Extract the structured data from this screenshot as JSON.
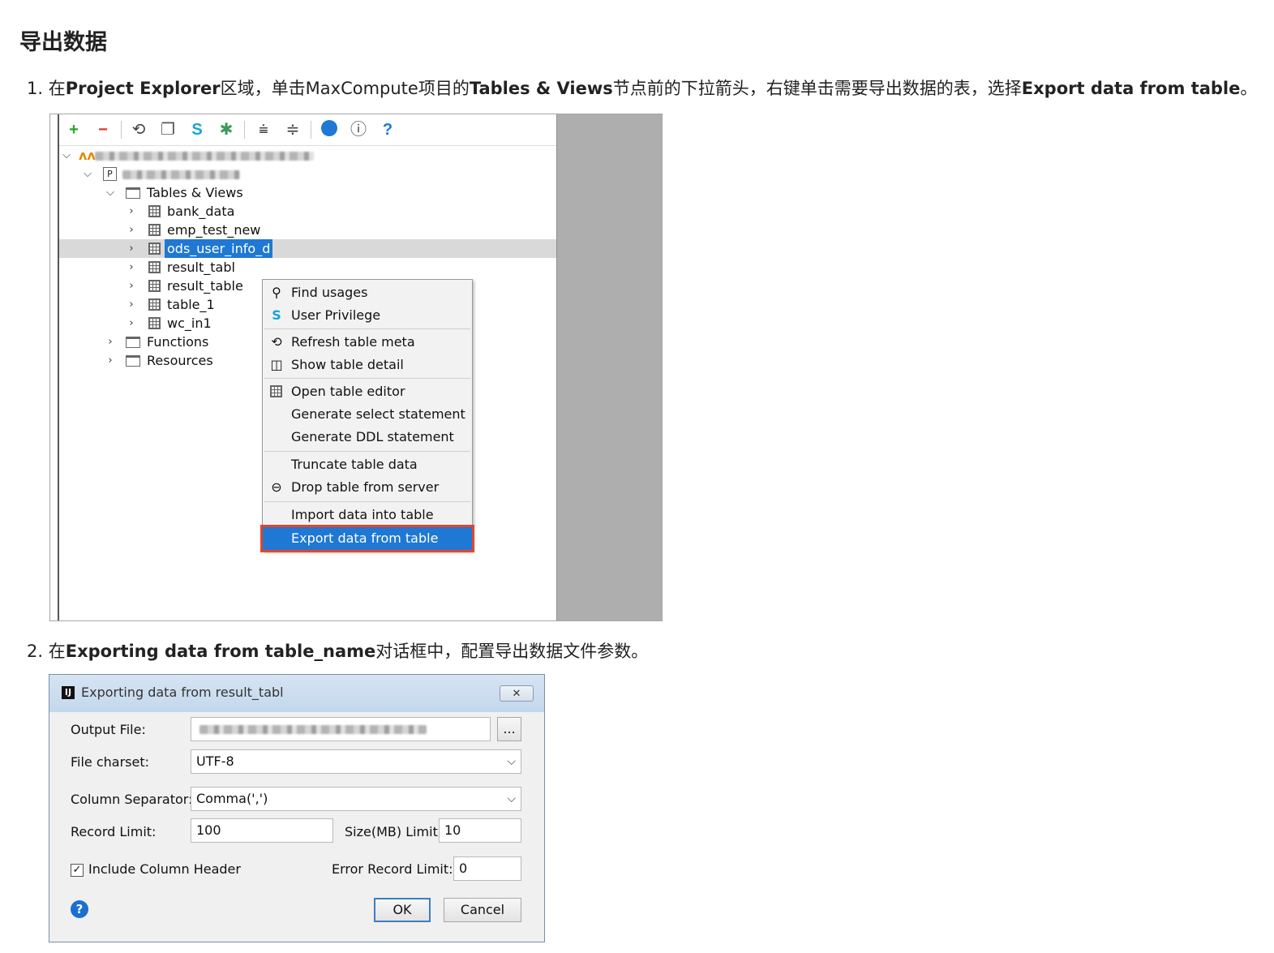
{
  "page": {
    "title": "导出数据",
    "step1": {
      "number": "1.",
      "p1": "在",
      "b1": "Project Explorer",
      "p2": "区域，单击MaxCompute项目的",
      "b2": "Tables & Views",
      "p3": "节点前的下拉箭头，右键单击需要导出数据的表，选择",
      "b3": "Export data from table",
      "p4": "。"
    },
    "step2": {
      "number": "2.",
      "p1": "在",
      "b1": "Exporting data from table_name",
      "p2": "对话框中，配置导出数据文件参数。"
    }
  },
  "explorer": {
    "toolbar_icons": [
      "plus-icon",
      "minus-icon",
      "refresh-icon",
      "copy-icon",
      "shield-icon",
      "bug-icon",
      "expand-all-icon",
      "collapse-all-icon",
      "chart-icon",
      "info-icon",
      "help-icon"
    ],
    "tables_views": "Tables & Views",
    "tables": [
      "bank_data",
      "emp_test_new",
      "ods_user_info_d",
      "result_tabl",
      "result_table",
      "table_1",
      "wc_in1"
    ],
    "selected_table": "ods_user_info_d",
    "functions": "Functions",
    "resources": "Resources"
  },
  "context_menu": {
    "find_usages": "Find usages",
    "user_privilege": "User Privilege",
    "refresh_meta": "Refresh table meta",
    "show_detail": "Show table detail",
    "open_editor": "Open table editor",
    "gen_select": "Generate select statement",
    "gen_ddl": "Generate DDL statement",
    "truncate": "Truncate table data",
    "drop": "Drop table from server",
    "import": "Import data into table",
    "export": "Export data from table"
  },
  "dialog": {
    "title": "Exporting data from result_tabl",
    "output_file_label": "Output File:",
    "browse": "...",
    "charset_label": "File charset:",
    "charset_value": "UTF-8",
    "separator_label": "Column Separator:",
    "separator_value": "Comma(',')",
    "record_limit_label": "Record Limit:",
    "record_limit_value": "100",
    "size_limit_label": "Size(MB) Limit:",
    "size_limit_value": "10",
    "include_header_label": "Include Column Header",
    "include_header_checked": true,
    "error_limit_label": "Error Record Limit:",
    "error_limit_value": "0",
    "ok": "OK",
    "cancel": "Cancel"
  },
  "colors": {
    "accent": "#1e78d4",
    "highlight_border": "#e0472c",
    "panel_gray": "#aeaeae"
  }
}
